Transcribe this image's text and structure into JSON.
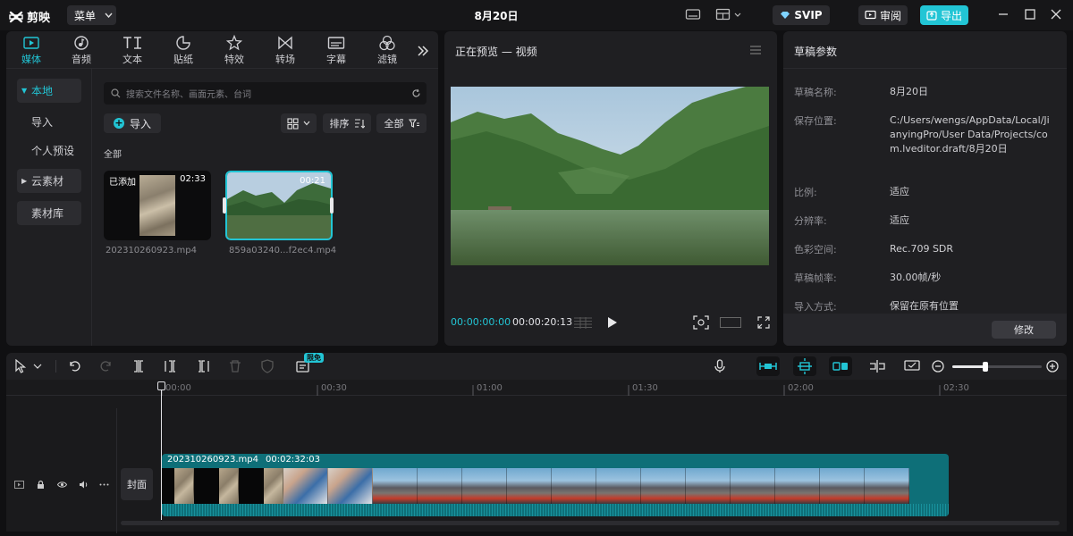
{
  "app": {
    "name": "剪映",
    "menu_label": "菜单",
    "project_title": "8月20日",
    "svip_label": "SVIP",
    "review_label": "审阅",
    "export_label": "导出",
    "accent": "#22c5d5"
  },
  "media_tools": [
    {
      "label": "媒体",
      "icon": "media-icon"
    },
    {
      "label": "音频",
      "icon": "audio-icon"
    },
    {
      "label": "文本",
      "icon": "text-icon"
    },
    {
      "label": "贴纸",
      "icon": "sticker-icon"
    },
    {
      "label": "特效",
      "icon": "effects-icon"
    },
    {
      "label": "转场",
      "icon": "transition-icon"
    },
    {
      "label": "字幕",
      "icon": "subtitle-icon"
    },
    {
      "label": "滤镜",
      "icon": "filter-icon"
    }
  ],
  "left_nav": {
    "local": "本地",
    "import": "导入",
    "personal_preset": "个人预设",
    "cloud": "云素材",
    "library": "素材库"
  },
  "media": {
    "search_placeholder": "搜索文件名称、画面元素、台词",
    "import_label": "导入",
    "sort_label": "排序",
    "filter_all_label": "全部",
    "section_label": "全部",
    "clips": [
      {
        "name": "202310260923.mp4",
        "duration": "02:33",
        "added_badge": "已添加"
      },
      {
        "name": "859a03240...f2ec4.mp4",
        "duration": "00:21"
      }
    ]
  },
  "preview": {
    "title": "正在预览 — 视频",
    "current_time": "00:00:00:00",
    "total_time": "00:00:20:13"
  },
  "properties": {
    "title": "草稿参数",
    "rows": [
      {
        "label": "草稿名称:",
        "value": "8月20日"
      },
      {
        "label": "保存位置:",
        "value": "C:/Users/wengs/AppData/Local/JianyingPro/User Data/Projects/com.lveditor.draft/8月20日"
      },
      {
        "label": "比例:",
        "value": "适应"
      },
      {
        "label": "分辨率:",
        "value": "适应"
      },
      {
        "label": "色彩空间:",
        "value": "Rec.709 SDR"
      },
      {
        "label": "草稿帧率:",
        "value": "30.00帧/秒"
      },
      {
        "label": "导入方式:",
        "value": "保留在原有位置"
      }
    ],
    "modify_label": "修改"
  },
  "timeline": {
    "free_badge": "限免",
    "ruler": [
      "00:00",
      "00:30",
      "01:00",
      "01:30",
      "02:00",
      "02:30"
    ],
    "cover_label": "封面",
    "clip": {
      "name": "202310260923.mp4",
      "duration": "00:02:32:03"
    },
    "zoom_level": 0.37
  }
}
